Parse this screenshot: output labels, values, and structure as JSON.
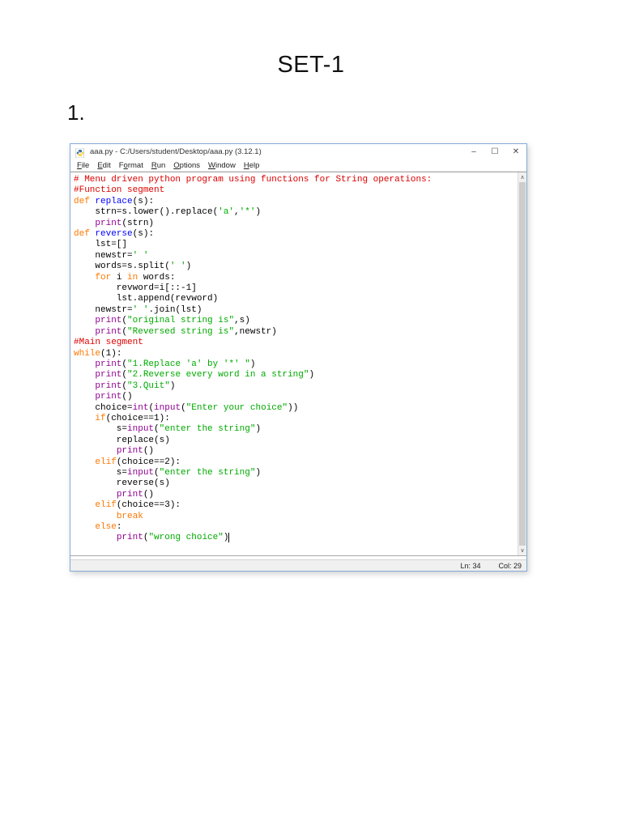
{
  "page": {
    "title": "SET-1",
    "item_number": "1."
  },
  "window": {
    "title": "aaa.py - C:/Users/student/Desktop/aaa.py (3.12.1)",
    "controls": {
      "minimize": "–",
      "maximize": "☐",
      "close": "✕"
    },
    "menu": [
      {
        "label": "File",
        "underline": 0
      },
      {
        "label": "Edit",
        "underline": 0
      },
      {
        "label": "Format",
        "underline": 1
      },
      {
        "label": "Run",
        "underline": 0
      },
      {
        "label": "Options",
        "underline": 0
      },
      {
        "label": "Window",
        "underline": 0
      },
      {
        "label": "Help",
        "underline": 0
      }
    ],
    "scrollbar": {
      "up_arrow": "∧",
      "down_arrow": "∨"
    },
    "status": {
      "line": "Ln: 34",
      "col": "Col: 29"
    }
  },
  "colors": {
    "comment": "#DD0000",
    "keyword": "#FF7700",
    "builtin": "#900090",
    "string": "#00AA00",
    "definition": "#0000FF",
    "plain": "#000000",
    "windowBorder": "#85A9D6",
    "statusBg": "#F0F0F0",
    "scrollTrack": "#F0F0F0",
    "scrollThumb": "#CDCDCD",
    "iconBlue": "#3873A3",
    "iconYellow": "#FFD43B"
  },
  "editor": {
    "lines": [
      [
        [
          "com",
          "# Menu driven python program using functions for String operations:"
        ]
      ],
      [
        [
          "com",
          "#Function segment"
        ]
      ],
      [
        [
          "kw",
          "def"
        ],
        [
          "pln",
          " "
        ],
        [
          "def",
          "replace"
        ],
        [
          "pln",
          "(s):"
        ]
      ],
      [
        [
          "pln",
          "    strn=s.lower().replace("
        ],
        [
          "str",
          "'a'"
        ],
        [
          "pln",
          ","
        ],
        [
          "str",
          "'*'"
        ],
        [
          "pln",
          ")"
        ]
      ],
      [
        [
          "pln",
          "    "
        ],
        [
          "blt",
          "print"
        ],
        [
          "pln",
          "(strn)"
        ]
      ],
      [
        [
          "kw",
          "def"
        ],
        [
          "pln",
          " "
        ],
        [
          "def",
          "reverse"
        ],
        [
          "pln",
          "(s):"
        ]
      ],
      [
        [
          "pln",
          "    lst=[]"
        ]
      ],
      [
        [
          "pln",
          "    newstr="
        ],
        [
          "str",
          "' '"
        ]
      ],
      [
        [
          "pln",
          "    words=s.split("
        ],
        [
          "str",
          "' '"
        ],
        [
          "pln",
          ")"
        ]
      ],
      [
        [
          "pln",
          "    "
        ],
        [
          "kw",
          "for"
        ],
        [
          "pln",
          " i "
        ],
        [
          "kw",
          "in"
        ],
        [
          "pln",
          " words:"
        ]
      ],
      [
        [
          "pln",
          "        revword=i[::-1]"
        ]
      ],
      [
        [
          "pln",
          "        lst.append(revword)"
        ]
      ],
      [
        [
          "pln",
          "    newstr="
        ],
        [
          "str",
          "' '"
        ],
        [
          "pln",
          ".join(lst)"
        ]
      ],
      [
        [
          "pln",
          "    "
        ],
        [
          "blt",
          "print"
        ],
        [
          "pln",
          "("
        ],
        [
          "str",
          "\"original string is\""
        ],
        [
          "pln",
          ",s)"
        ]
      ],
      [
        [
          "pln",
          "    "
        ],
        [
          "blt",
          "print"
        ],
        [
          "pln",
          "("
        ],
        [
          "str",
          "\"Reversed string is\""
        ],
        [
          "pln",
          ",newstr)"
        ]
      ],
      [
        [
          "com",
          "#Main segment"
        ]
      ],
      [
        [
          "kw",
          "while"
        ],
        [
          "pln",
          "(1):"
        ]
      ],
      [
        [
          "pln",
          "    "
        ],
        [
          "blt",
          "print"
        ],
        [
          "pln",
          "("
        ],
        [
          "str",
          "\"1.Replace 'a' by '*' \""
        ],
        [
          "pln",
          ")"
        ]
      ],
      [
        [
          "pln",
          "    "
        ],
        [
          "blt",
          "print"
        ],
        [
          "pln",
          "("
        ],
        [
          "str",
          "\"2.Reverse every word in a string\""
        ],
        [
          "pln",
          ")"
        ]
      ],
      [
        [
          "pln",
          "    "
        ],
        [
          "blt",
          "print"
        ],
        [
          "pln",
          "("
        ],
        [
          "str",
          "\"3.Quit\""
        ],
        [
          "pln",
          ")"
        ]
      ],
      [
        [
          "pln",
          "    "
        ],
        [
          "blt",
          "print"
        ],
        [
          "pln",
          "()"
        ]
      ],
      [
        [
          "pln",
          "    choice="
        ],
        [
          "blt",
          "int"
        ],
        [
          "pln",
          "("
        ],
        [
          "blt",
          "input"
        ],
        [
          "pln",
          "("
        ],
        [
          "str",
          "\"Enter your choice\""
        ],
        [
          "pln",
          "))"
        ]
      ],
      [
        [
          "pln",
          "    "
        ],
        [
          "kw",
          "if"
        ],
        [
          "pln",
          "(choice==1):"
        ]
      ],
      [
        [
          "pln",
          "        s="
        ],
        [
          "blt",
          "input"
        ],
        [
          "pln",
          "("
        ],
        [
          "str",
          "\"enter the string\""
        ],
        [
          "pln",
          ")"
        ]
      ],
      [
        [
          "pln",
          "        replace(s)"
        ]
      ],
      [
        [
          "pln",
          "        "
        ],
        [
          "blt",
          "print"
        ],
        [
          "pln",
          "()"
        ]
      ],
      [
        [
          "pln",
          "    "
        ],
        [
          "kw",
          "elif"
        ],
        [
          "pln",
          "(choice==2):"
        ]
      ],
      [
        [
          "pln",
          "        s="
        ],
        [
          "blt",
          "input"
        ],
        [
          "pln",
          "("
        ],
        [
          "str",
          "\"enter the string\""
        ],
        [
          "pln",
          ")"
        ]
      ],
      [
        [
          "pln",
          "        reverse(s)"
        ]
      ],
      [
        [
          "pln",
          "        "
        ],
        [
          "blt",
          "print"
        ],
        [
          "pln",
          "()"
        ]
      ],
      [
        [
          "pln",
          "    "
        ],
        [
          "kw",
          "elif"
        ],
        [
          "pln",
          "(choice==3):"
        ]
      ],
      [
        [
          "pln",
          "        "
        ],
        [
          "kw",
          "break"
        ]
      ],
      [
        [
          "pln",
          "    "
        ],
        [
          "kw",
          "else"
        ],
        [
          "pln",
          ":"
        ]
      ],
      [
        [
          "pln",
          "        "
        ],
        [
          "blt",
          "print"
        ],
        [
          "pln",
          "("
        ],
        [
          "str",
          "\"wrong choice\""
        ],
        [
          "pln",
          ")"
        ],
        [
          "cursor",
          ""
        ]
      ]
    ]
  }
}
